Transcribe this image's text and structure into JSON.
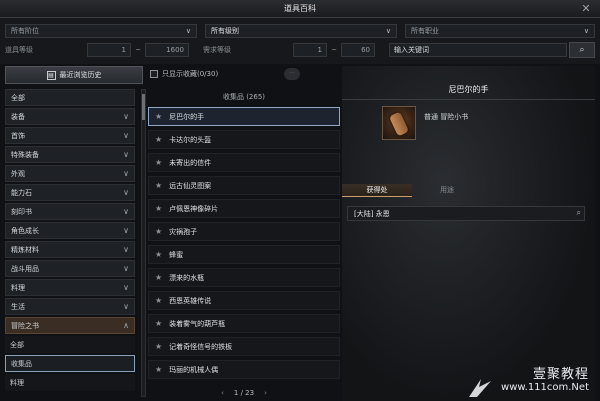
{
  "window": {
    "title": "道具百科",
    "close_icon": "close-icon"
  },
  "filters": {
    "slot_select": "所有阶位",
    "grade_select": "所有级别",
    "class_select": "所有职业",
    "item_level_label": "道具等级",
    "item_level_min": "1",
    "item_level_max": "1600",
    "range_sep": "~",
    "req_level_label": "需求等级",
    "req_level_min": "1",
    "req_level_max": "60",
    "search_placeholder": "输入关键词"
  },
  "sidebar": {
    "history_button": "最近浏览历史",
    "categories": [
      {
        "label": "全部"
      },
      {
        "label": "装备"
      },
      {
        "label": "首饰"
      },
      {
        "label": "特殊装备"
      },
      {
        "label": "外观"
      },
      {
        "label": "能力石"
      },
      {
        "label": "刻印书"
      },
      {
        "label": "角色成长"
      },
      {
        "label": "精炼材料"
      },
      {
        "label": "战斗用品"
      },
      {
        "label": "料理"
      },
      {
        "label": "生活"
      },
      {
        "label": "冒险之书"
      }
    ],
    "subcategories": [
      {
        "label": "全部"
      },
      {
        "label": "收集品"
      },
      {
        "label": "料理"
      }
    ]
  },
  "middle": {
    "favorites_only": "只显示收藏(0/30)",
    "list_header": "收集品 (265)",
    "items": [
      {
        "label": "尼巴尔的手"
      },
      {
        "label": "卡达尔的头盔"
      },
      {
        "label": "未寄出的信件"
      },
      {
        "label": "远古仙灵图案"
      },
      {
        "label": "卢佩恩神像碎片"
      },
      {
        "label": "灾祸孢子"
      },
      {
        "label": "蜂蜜"
      },
      {
        "label": "漂来的水瓶"
      },
      {
        "label": "西恩英雄传说"
      },
      {
        "label": "装着雾气的葫芦瓶"
      },
      {
        "label": "记着奇怪信号的铁板"
      },
      {
        "label": "玛丽的机械人偶"
      }
    ],
    "page": "1 / 23"
  },
  "detail": {
    "item_name": "尼巴尔的手",
    "grade_type": "普通 冒险小书",
    "tab_obtain": "获得处",
    "tab_use": "用途",
    "source": "[大陆] 永恩"
  },
  "watermark": {
    "cn": "壹聚教程",
    "url": "www.111com.Net"
  }
}
